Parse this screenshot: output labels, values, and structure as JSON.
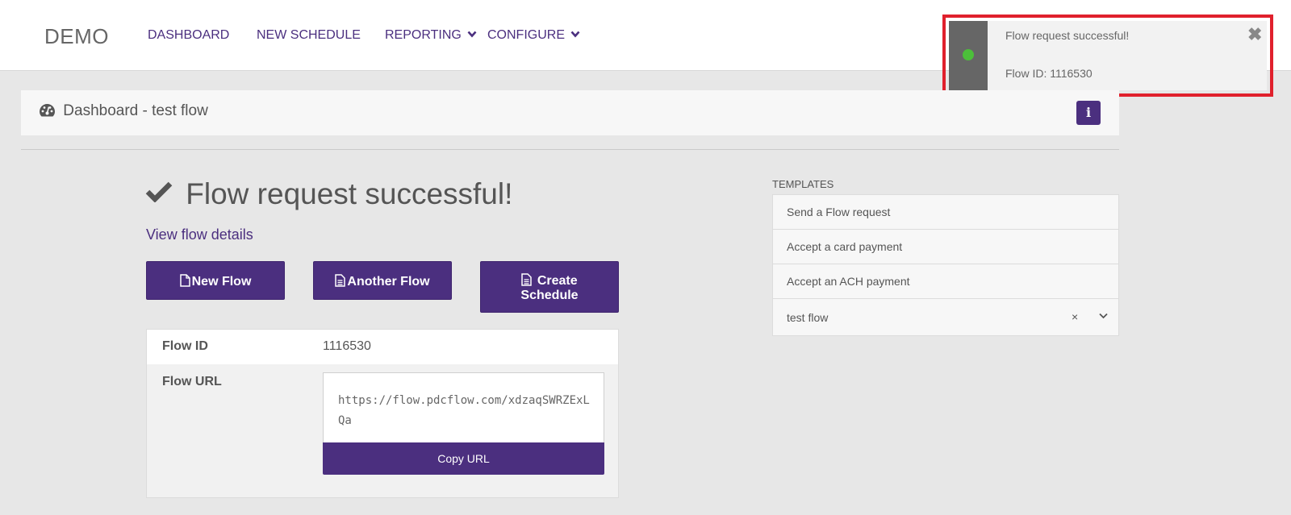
{
  "nav": {
    "brand": "DEMO",
    "items": [
      {
        "label": "DASHBOARD"
      },
      {
        "label": "NEW SCHEDULE"
      },
      {
        "label": "REPORTING"
      },
      {
        "label": "CONFIGURE"
      }
    ]
  },
  "toast": {
    "message": "Flow request successful!",
    "flow_id_text": "Flow ID: 1116530",
    "close_symbol": "✖",
    "status_color": "#4cbf3a"
  },
  "header": {
    "title": "Dashboard - test flow",
    "info_symbol": "i"
  },
  "success": {
    "title": "Flow request successful!",
    "view_link": "View flow details"
  },
  "actions": {
    "new_flow": "New Flow",
    "another_flow": "Another Flow",
    "create_schedule_line1": "Create",
    "create_schedule_line2": "Schedule"
  },
  "details": {
    "flow_id_label": "Flow ID",
    "flow_id_value": "1116530",
    "flow_url_label": "Flow URL",
    "flow_url_value": "https://flow.pdcflow.com/xdzaqSWRZExLQa",
    "copy_button": "Copy URL"
  },
  "templates": {
    "heading": "TEMPLATES",
    "items": [
      {
        "label": "Send a Flow request"
      },
      {
        "label": "Accept a card payment"
      },
      {
        "label": "Accept an ACH payment"
      }
    ],
    "selected": "test flow",
    "clear_symbol": "×"
  },
  "colors": {
    "accent": "#4b2f7f",
    "highlight_border": "#e0202c"
  }
}
